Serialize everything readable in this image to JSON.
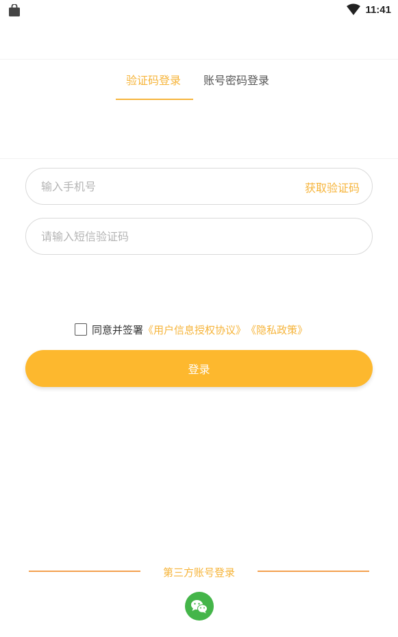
{
  "status_bar": {
    "time": "11:41"
  },
  "tabs": [
    {
      "label": "验证码登录",
      "active": true
    },
    {
      "label": "账号密码登录",
      "active": false
    }
  ],
  "phone_field": {
    "placeholder": "输入手机号",
    "value": "",
    "action_label": "获取验证码"
  },
  "code_field": {
    "placeholder": "请输入短信验证码",
    "value": ""
  },
  "agreement": {
    "checked": false,
    "prefix": "同意并签署",
    "link1": "《用户信息授权协议》",
    "link2": "《隐私政策》"
  },
  "login_button": {
    "label": "登录"
  },
  "third_party": {
    "label": "第三方账号登录",
    "icons": [
      "wechat-icon"
    ]
  },
  "colors": {
    "accent": "#F6B43A",
    "button": "#FDB82E",
    "wechat": "#44B549"
  }
}
